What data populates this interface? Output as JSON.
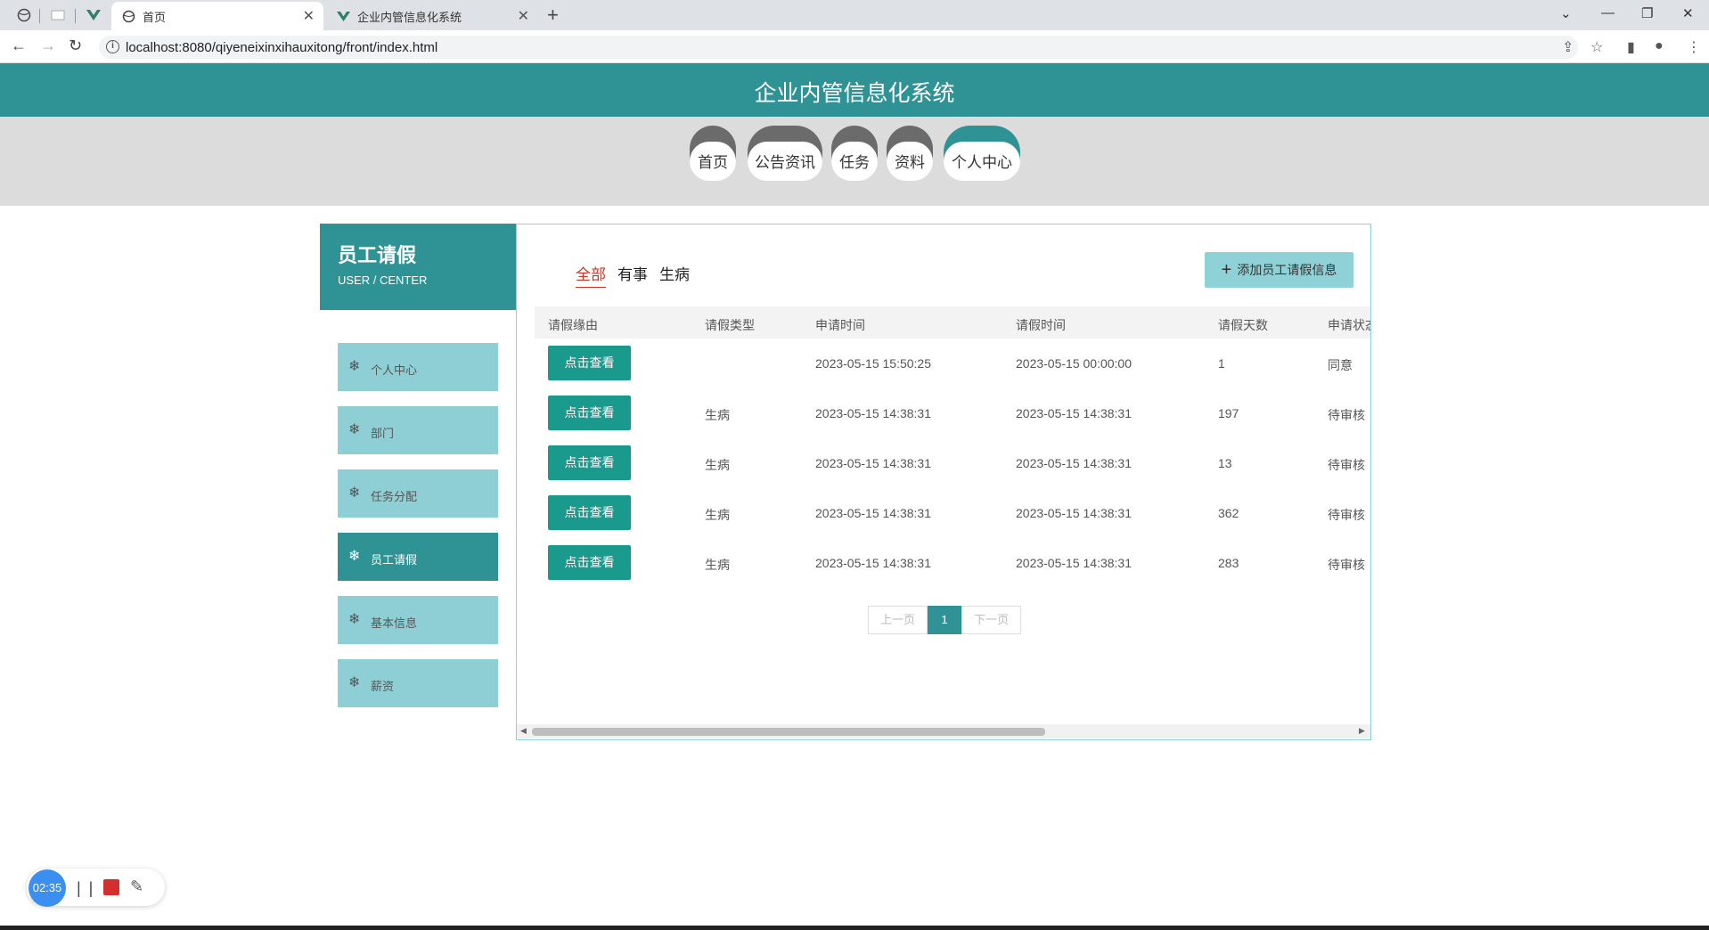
{
  "browser": {
    "tabs": [
      {
        "title": "首页",
        "icon": "globe-icon",
        "active": true
      },
      {
        "title": "企业内管信息化系统",
        "icon": "vue-logo-icon",
        "active": false
      }
    ],
    "url": "localhost:8080/qiyeneixinxihauxitong/front/index.html"
  },
  "site": {
    "title": "企业内管信息化系统",
    "nav": [
      "首页",
      "公告资讯",
      "任务",
      "资料",
      "个人中心"
    ],
    "active_nav": "个人中心"
  },
  "sidebar": {
    "title": "员工请假",
    "subtitle": "USER / CENTER",
    "items": [
      "个人中心",
      "部门",
      "任务分配",
      "员工请假",
      "基本信息",
      "薪资"
    ],
    "active": "员工请假"
  },
  "main": {
    "filters": [
      "全部",
      "有事",
      "生病"
    ],
    "active_filter": "全部",
    "add_button": "添加员工请假信息",
    "columns": [
      "请假缘由",
      "请假类型",
      "申请时间",
      "请假时间",
      "请假天数",
      "申请状态"
    ],
    "rows": [
      {
        "reason_btn": "点击查看",
        "type": "",
        "apply_time": "2023-05-15 15:50:25",
        "leave_time": "2023-05-15 00:00:00",
        "days": "1",
        "status": "同意"
      },
      {
        "reason_btn": "点击查看",
        "type": "生病",
        "apply_time": "2023-05-15 14:38:31",
        "leave_time": "2023-05-15 14:38:31",
        "days": "197",
        "status": "待审核"
      },
      {
        "reason_btn": "点击查看",
        "type": "生病",
        "apply_time": "2023-05-15 14:38:31",
        "leave_time": "2023-05-15 14:38:31",
        "days": "13",
        "status": "待审核"
      },
      {
        "reason_btn": "点击查看",
        "type": "生病",
        "apply_time": "2023-05-15 14:38:31",
        "leave_time": "2023-05-15 14:38:31",
        "days": "362",
        "status": "待审核"
      },
      {
        "reason_btn": "点击查看",
        "type": "生病",
        "apply_time": "2023-05-15 14:38:31",
        "leave_time": "2023-05-15 14:38:31",
        "days": "283",
        "status": "待审核"
      }
    ],
    "pager": {
      "prev": "上一页",
      "current": "1",
      "next": "下一页"
    }
  },
  "recorder": {
    "time": "02:35"
  },
  "colors": {
    "brand": "#2f9396",
    "sidebar_item": "#8ecfd6",
    "view_button": "#1a9a8d",
    "filter_active": "#c0392b"
  }
}
